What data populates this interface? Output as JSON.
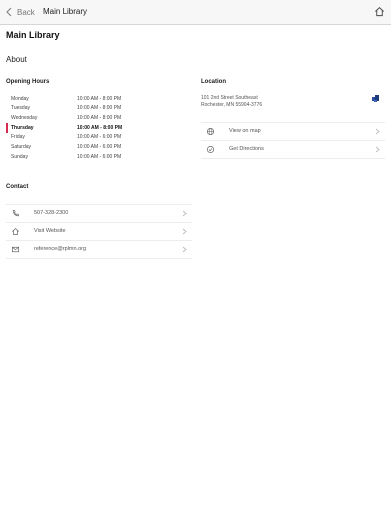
{
  "nav": {
    "back_label": "Back",
    "title": "Main Library"
  },
  "page": {
    "title": "Main Library",
    "about_heading": "About"
  },
  "hours": {
    "heading": "Opening Hours",
    "today_index": 3,
    "rows": [
      {
        "day": "Monday",
        "time": "10:00 AM - 8:00 PM"
      },
      {
        "day": "Tuesday",
        "time": "10:00 AM - 8:00 PM"
      },
      {
        "day": "Wednesday",
        "time": "10:00 AM - 8:00 PM"
      },
      {
        "day": "Thursday",
        "time": "10:00 AM - 8:00 PM"
      },
      {
        "day": "Friday",
        "time": "10:00 AM - 6:00 PM"
      },
      {
        "day": "Saturday",
        "time": "10:00 AM - 6:00 PM"
      },
      {
        "day": "Sunday",
        "time": "10:00 AM - 6:00 PM"
      }
    ]
  },
  "location": {
    "heading": "Location",
    "address_line1": "101 2nd Street Southeast",
    "address_line2": "Rochester, MN 55904-3776",
    "actions": [
      {
        "label": "View on map",
        "icon": "globe-icon"
      },
      {
        "label": "Get Directions",
        "icon": "compass-icon"
      }
    ]
  },
  "contact": {
    "heading": "Contact",
    "items": [
      {
        "label": "507-328-2300",
        "icon": "phone-icon"
      },
      {
        "label": "Visit Website",
        "icon": "home-icon"
      },
      {
        "label": "reference@rplmn.org",
        "icon": "mail-icon"
      }
    ]
  },
  "colors": {
    "today_marker": "#d42b4f",
    "pin": "#2b4c9a"
  }
}
